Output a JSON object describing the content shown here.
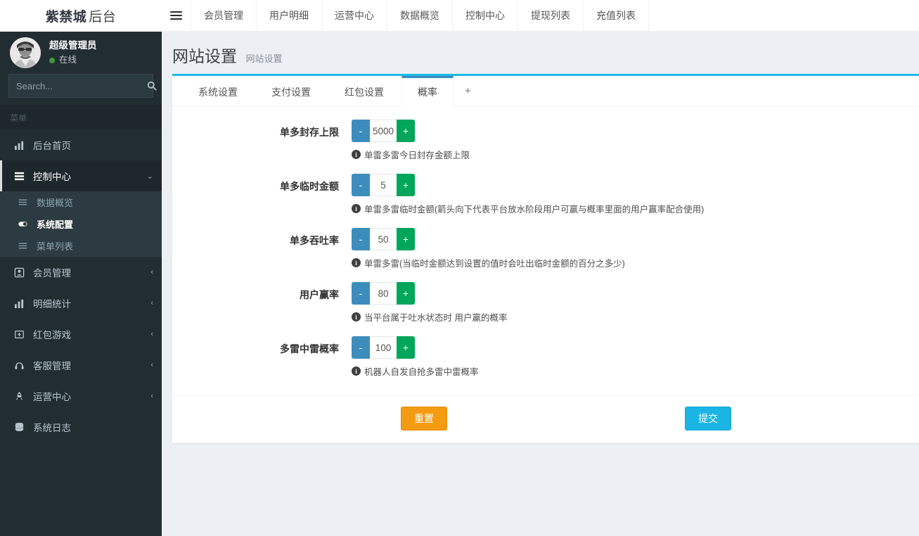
{
  "brand": {
    "name": "紫禁城",
    "suffix": "后台"
  },
  "topnav": {
    "menu_icon": "hamburger-icon",
    "items": [
      {
        "label": "会员管理"
      },
      {
        "label": "用户明细"
      },
      {
        "label": "运营中心"
      },
      {
        "label": "数据概览"
      },
      {
        "label": "控制中心"
      },
      {
        "label": "提现列表"
      },
      {
        "label": "充值列表"
      }
    ]
  },
  "sidebar": {
    "user": {
      "name": "超级管理员",
      "status": "在线",
      "status_color": "#3c9b3c"
    },
    "search": {
      "value": "",
      "placeholder": "Search...",
      "icon": "search-icon"
    },
    "menu_header": "菜单",
    "items": [
      {
        "label": "后台首页",
        "icon": "bar-chart-icon",
        "arrow": "",
        "active": false
      },
      {
        "label": "控制中心",
        "icon": "list-icon",
        "arrow": "⌄",
        "active": true,
        "submenu": [
          {
            "label": "数据概览",
            "icon": "menu-lines-icon",
            "active": false
          },
          {
            "label": "系统配置",
            "icon": "toggle-icon",
            "active": true
          },
          {
            "label": "菜单列表",
            "icon": "menu-lines-icon",
            "active": false
          }
        ]
      },
      {
        "label": "会员管理",
        "icon": "users-icon",
        "arrow": "‹",
        "active": false
      },
      {
        "label": "明细统计",
        "icon": "bar-chart-icon",
        "arrow": "‹",
        "active": false
      },
      {
        "label": "红包游戏",
        "icon": "gift-icon",
        "arrow": "‹",
        "active": false
      },
      {
        "label": "客服管理",
        "icon": "headset-icon",
        "arrow": "‹",
        "active": false
      },
      {
        "label": "运营中心",
        "icon": "rocket-icon",
        "arrow": "‹",
        "active": false
      },
      {
        "label": "系统日志",
        "icon": "database-icon",
        "arrow": "",
        "active": false
      }
    ]
  },
  "page": {
    "title": "网站设置",
    "subtitle": "网站设置"
  },
  "tabs": [
    {
      "label": "系统设置",
      "active": false
    },
    {
      "label": "支付设置",
      "active": false
    },
    {
      "label": "红包设置",
      "active": false
    },
    {
      "label": "概率",
      "active": true
    }
  ],
  "tab_add_label": "+",
  "form": {
    "rows": [
      {
        "label": "单多封存上限",
        "value": "5000",
        "hint": "单雷多雷今日封存金额上限",
        "minus": "-",
        "plus": "+"
      },
      {
        "label": "单多临时金额",
        "value": "5",
        "hint": "单雷多雷临时金额(箭头向下代表平台放水阶段用户可赢与概率里面的用户赢率配合使用)",
        "minus": "-",
        "plus": "+"
      },
      {
        "label": "单多吞吐率",
        "value": "50",
        "hint": "单雷多雷(当临时金额达到设置的值时会吐出临时金额的百分之多少)",
        "minus": "-",
        "plus": "+"
      },
      {
        "label": "用户赢率",
        "value": "80",
        "hint": "当平台属于吐水状态时 用户赢的概率",
        "minus": "-",
        "plus": "+"
      },
      {
        "label": "多雷中雷概率",
        "value": "100",
        "hint": "机器人自发自抢多雷中雷概率",
        "minus": "-",
        "plus": "+"
      }
    ]
  },
  "footer": {
    "reset_label": "重置",
    "submit_label": "提交"
  },
  "colors": {
    "sidebar_bg": "#222d32",
    "accent_cyan": "#1bbbe9",
    "tab_active": "#3c8dbc",
    "minus_btn": "#3c8dbc",
    "plus_btn": "#00a65a",
    "reset_btn": "#f39c12",
    "submit_btn": "#1ab5e4",
    "page_bg": "#ecf0f5"
  }
}
